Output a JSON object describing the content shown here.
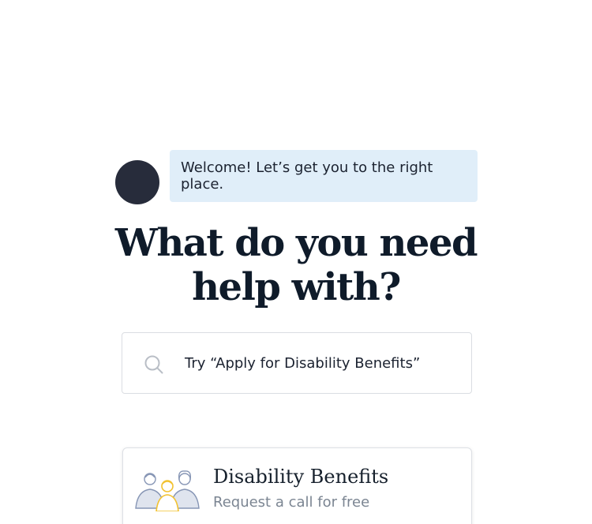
{
  "welcome": {
    "message": "Welcome! Let’s get you to the right place."
  },
  "heading": {
    "line1": "What do you need",
    "line2": "help with?"
  },
  "search": {
    "icon": "search-icon",
    "placeholder": "Try “Apply for Disability Benefits”"
  },
  "cards": [
    {
      "icon": "people-group-icon",
      "title": "Disability Benefits",
      "subtitle": "Request a call for free"
    }
  ],
  "colors": {
    "bubble_bg": "#e0eef9",
    "avatar": "#272c3b",
    "heading": "#0f1b2a",
    "accent_yellow": "#f2c230",
    "illustration_blue": "#8796b5"
  }
}
